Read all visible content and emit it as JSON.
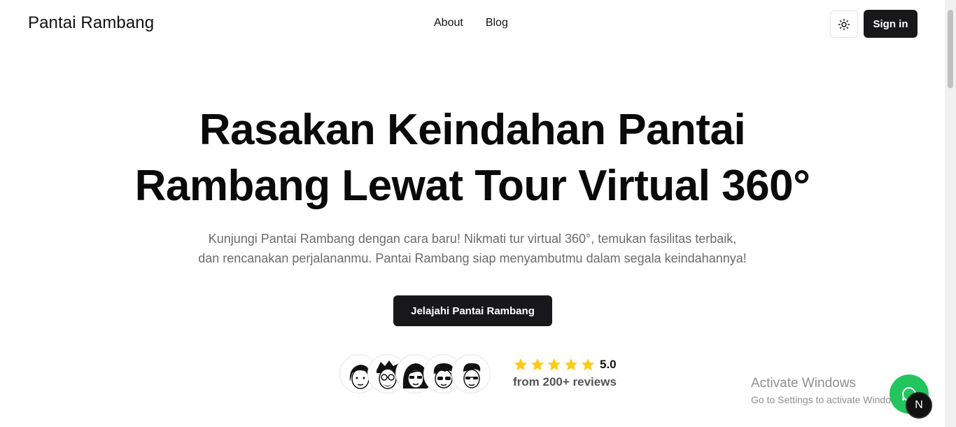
{
  "header": {
    "brand": "Pantai Rambang",
    "nav": [
      {
        "label": "About"
      },
      {
        "label": "Blog"
      }
    ],
    "theme_icon": "sun-icon",
    "signin_label": "Sign in"
  },
  "hero": {
    "title_line1": "Rasakan Keindahan Pantai",
    "title_line2": "Rambang Lewat Tour Virtual 360°",
    "subtitle_line1": "Kunjungi Pantai Rambang dengan cara baru! Nikmati tur virtual 360°, temukan fasilitas terbaik,",
    "subtitle_line2": "dan rencanakan perjalananmu. Pantai Rambang siap menyambutmu dalam segala keindahannya!",
    "cta_label": "Jelajahi Pantai Rambang"
  },
  "social_proof": {
    "avatar_count": 5,
    "stars": 5,
    "star_color": "#facc15",
    "rating": "5.0",
    "reviews_text": "from 200+ reviews"
  },
  "overlay": {
    "activate_title": "Activate Windows",
    "activate_sub": "Go to Settings to activate Windows.",
    "chat_icon": "chat-bubble-icon",
    "chat_color": "#22c55e",
    "badge_letter": "N"
  }
}
